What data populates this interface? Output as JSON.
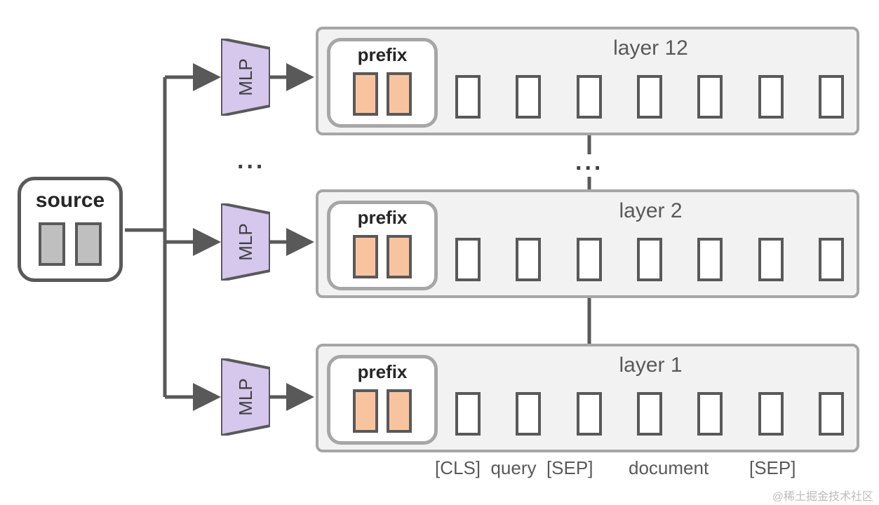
{
  "source": {
    "label": "source"
  },
  "mlp_label": "MLP",
  "layers": [
    {
      "title": "layer 12",
      "prefix": "prefix"
    },
    {
      "title": "layer 2",
      "prefix": "prefix"
    },
    {
      "title": "layer 1",
      "prefix": "prefix"
    }
  ],
  "footer": "[CLS]  query  [SEP]       document        [SEP]",
  "ellipsis": "...",
  "watermark": "@稀土掘金技术社区"
}
